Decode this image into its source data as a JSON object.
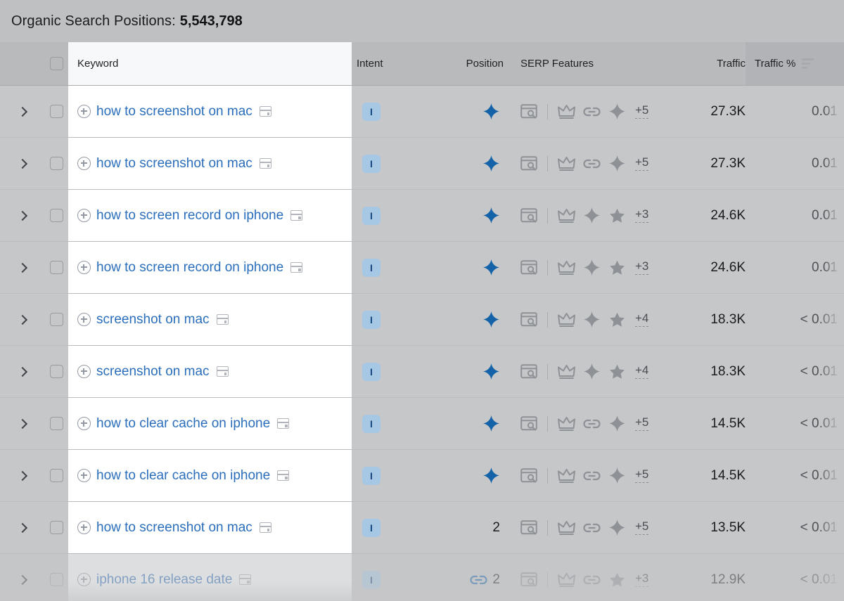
{
  "header": {
    "title_label": "Organic Search Positions:",
    "count": "5,543,798"
  },
  "table": {
    "columns": {
      "keyword": "Keyword",
      "intent": "Intent",
      "position": "Position",
      "serp_features": "SERP Features",
      "traffic": "Traffic",
      "traffic_pct": "Traffic %"
    },
    "sorted_column": "traffic_pct",
    "sort_icon": "sort-descending-icon",
    "select_all_checkbox": "unchecked",
    "colors": {
      "keyword_link": "#2a6ebb",
      "ai_overview_blue": "#1463a8",
      "intent_badge_bg": "#a6c8e4",
      "intent_badge_text": "#17477e",
      "header_bg": "#b9babc",
      "sorted_header_bg": "#b1b3b6",
      "row_bg": "#c6c7c9",
      "keyword_cell_bg": "#ffffff",
      "titlebar_bg": "#bfc0c2"
    },
    "rows": [
      {
        "keyword": "how to screenshot on mac",
        "intent": "I",
        "position": "",
        "position_icon": "ai-overview-icon",
        "position_link_icon": false,
        "serp_features": [
          "browser-search-icon",
          "divider",
          "crown-icon",
          "link-icon",
          "ai-overview-gray-icon"
        ],
        "serp_more": "+5",
        "traffic": "27.3K",
        "traffic_pct": "0.01",
        "faded": false
      },
      {
        "keyword": "how to screenshot on mac",
        "intent": "I",
        "position": "",
        "position_icon": "ai-overview-icon",
        "position_link_icon": false,
        "serp_features": [
          "browser-search-icon",
          "divider",
          "crown-icon",
          "link-icon",
          "ai-overview-gray-icon"
        ],
        "serp_more": "+5",
        "traffic": "27.3K",
        "traffic_pct": "0.01",
        "faded": false
      },
      {
        "keyword": "how to screen record on iphone",
        "intent": "I",
        "position": "",
        "position_icon": "ai-overview-icon",
        "position_link_icon": false,
        "serp_features": [
          "browser-search-icon",
          "divider",
          "crown-icon",
          "ai-overview-gray-icon",
          "star-icon"
        ],
        "serp_more": "+3",
        "traffic": "24.6K",
        "traffic_pct": "0.01",
        "faded": false
      },
      {
        "keyword": "how to screen record on iphone",
        "intent": "I",
        "position": "",
        "position_icon": "ai-overview-icon",
        "position_link_icon": false,
        "serp_features": [
          "browser-search-icon",
          "divider",
          "crown-icon",
          "ai-overview-gray-icon",
          "star-icon"
        ],
        "serp_more": "+3",
        "traffic": "24.6K",
        "traffic_pct": "0.01",
        "faded": false
      },
      {
        "keyword": "screenshot on mac",
        "intent": "I",
        "position": "",
        "position_icon": "ai-overview-icon",
        "position_link_icon": false,
        "serp_features": [
          "browser-search-icon",
          "divider",
          "crown-icon",
          "ai-overview-gray-icon",
          "star-icon"
        ],
        "serp_more": "+4",
        "traffic": "18.3K",
        "traffic_pct": "< 0.01",
        "faded": false
      },
      {
        "keyword": "screenshot on mac",
        "intent": "I",
        "position": "",
        "position_icon": "ai-overview-icon",
        "position_link_icon": false,
        "serp_features": [
          "browser-search-icon",
          "divider",
          "crown-icon",
          "ai-overview-gray-icon",
          "star-icon"
        ],
        "serp_more": "+4",
        "traffic": "18.3K",
        "traffic_pct": "< 0.01",
        "faded": false
      },
      {
        "keyword": "how to clear cache on iphone",
        "intent": "I",
        "position": "",
        "position_icon": "ai-overview-icon",
        "position_link_icon": false,
        "serp_features": [
          "browser-search-icon",
          "divider",
          "crown-icon",
          "link-icon",
          "ai-overview-gray-icon"
        ],
        "serp_more": "+5",
        "traffic": "14.5K",
        "traffic_pct": "< 0.01",
        "faded": false
      },
      {
        "keyword": "how to clear cache on iphone",
        "intent": "I",
        "position": "",
        "position_icon": "ai-overview-icon",
        "position_link_icon": false,
        "serp_features": [
          "browser-search-icon",
          "divider",
          "crown-icon",
          "link-icon",
          "ai-overview-gray-icon"
        ],
        "serp_more": "+5",
        "traffic": "14.5K",
        "traffic_pct": "< 0.01",
        "faded": false
      },
      {
        "keyword": "how to screenshot on mac",
        "intent": "I",
        "position": "2",
        "position_icon": "",
        "position_link_icon": false,
        "serp_features": [
          "browser-search-icon",
          "divider",
          "crown-icon",
          "link-icon",
          "ai-overview-gray-icon"
        ],
        "serp_more": "+5",
        "traffic": "13.5K",
        "traffic_pct": "< 0.01",
        "faded": false
      },
      {
        "keyword": "iphone 16 release date",
        "intent": "I",
        "position": "2",
        "position_icon": "",
        "position_link_icon": true,
        "serp_features": [
          "browser-search-icon",
          "divider",
          "crown-icon",
          "link-icon",
          "star-icon"
        ],
        "serp_more": "+3",
        "traffic": "12.9K",
        "traffic_pct": "< 0.01",
        "faded": true
      }
    ]
  }
}
